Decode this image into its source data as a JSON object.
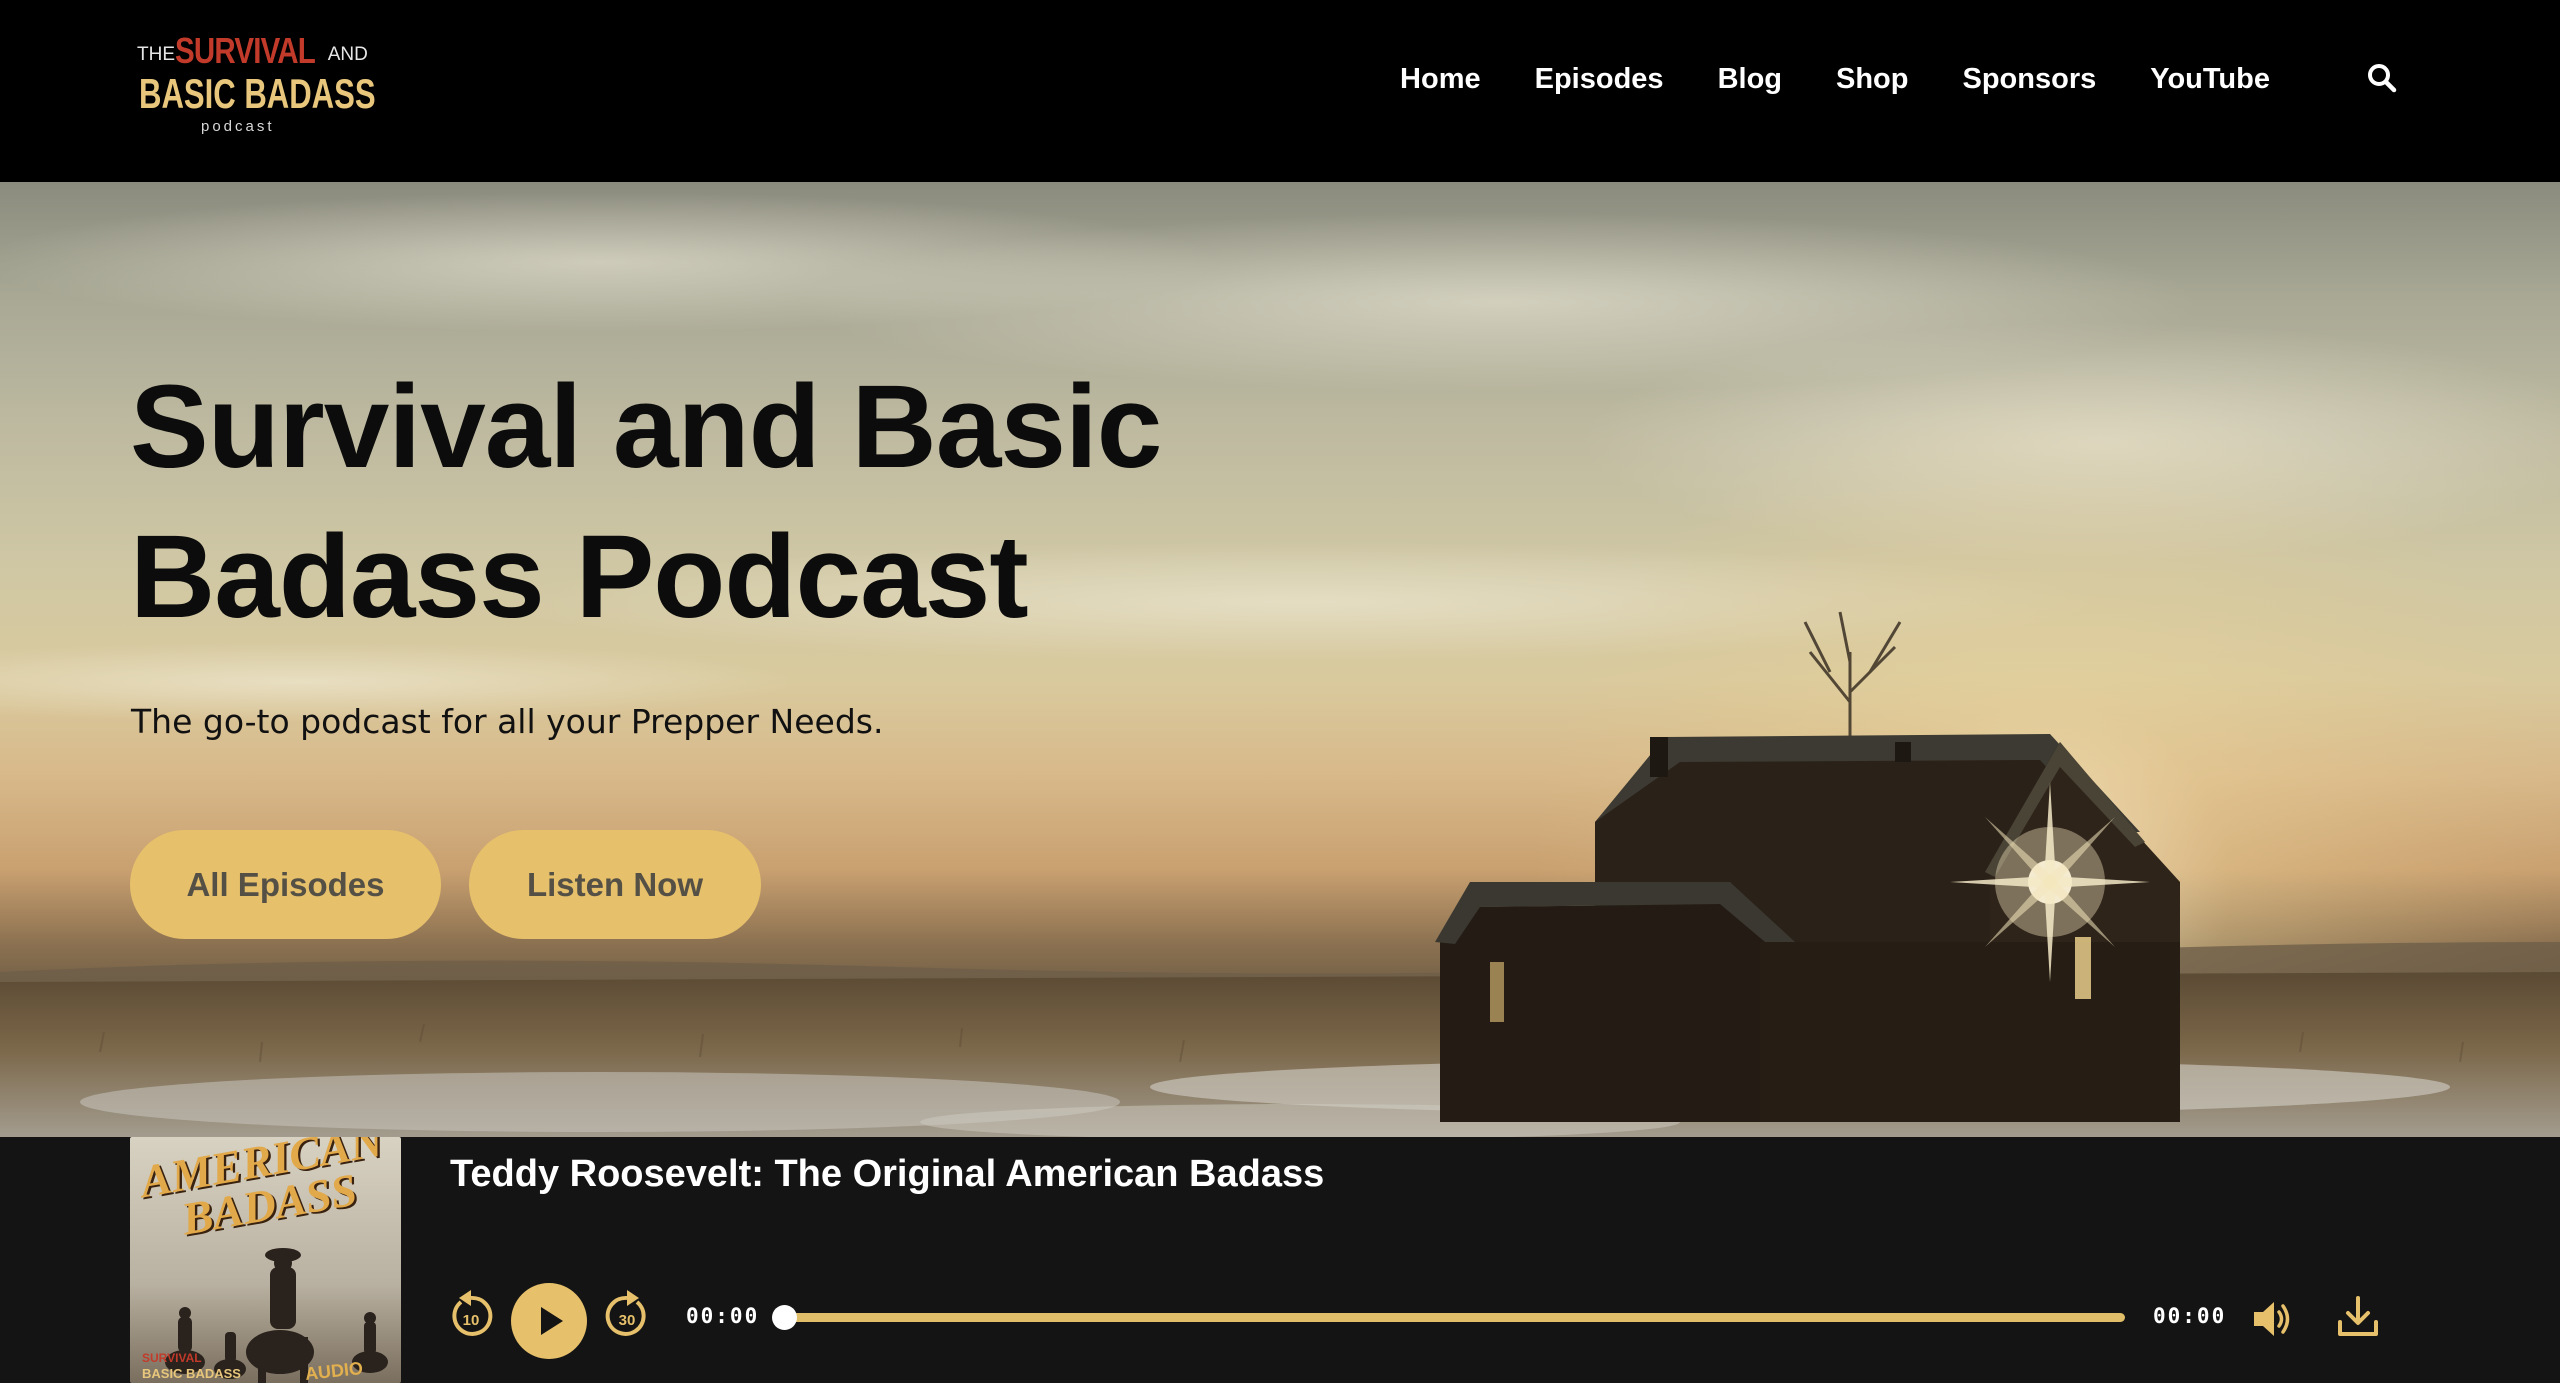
{
  "logo": {
    "the": "THE",
    "survival": "SURVIVAL",
    "and": "AND",
    "basic_badass": "BASIC BADASS",
    "podcast": "podcast"
  },
  "nav": {
    "items": [
      "Home",
      "Episodes",
      "Blog",
      "Shop",
      "Sponsors",
      "YouTube"
    ]
  },
  "hero": {
    "title": "Survival and Basic Badass Podcast",
    "subtitle": "The go-to podcast for all your Prepper Needs.",
    "button_all_episodes": "All Episodes",
    "button_listen_now": "Listen Now"
  },
  "player": {
    "episode_title": "Teddy Roosevelt: The Original American Badass",
    "cover": {
      "title": "AMERICAN BADASS",
      "badge": "AUDIO ONLY",
      "brand_top": "SURVIVAL",
      "brand_bottom": "BASIC BADASS"
    },
    "rewind_seconds": "10",
    "forward_seconds": "30",
    "current_time": "00:00",
    "duration": "00:00",
    "progress": 0
  },
  "colors": {
    "accent": "#e6c06a",
    "header_bg": "#000000",
    "player_bg": "#141414",
    "logo_red": "#c23a2a",
    "logo_gold": "#e8c77c"
  },
  "icons": {
    "search": "search-icon",
    "rewind": "rewind-10-icon",
    "play": "play-icon",
    "forward": "forward-30-icon",
    "volume": "volume-icon",
    "download": "download-icon"
  }
}
